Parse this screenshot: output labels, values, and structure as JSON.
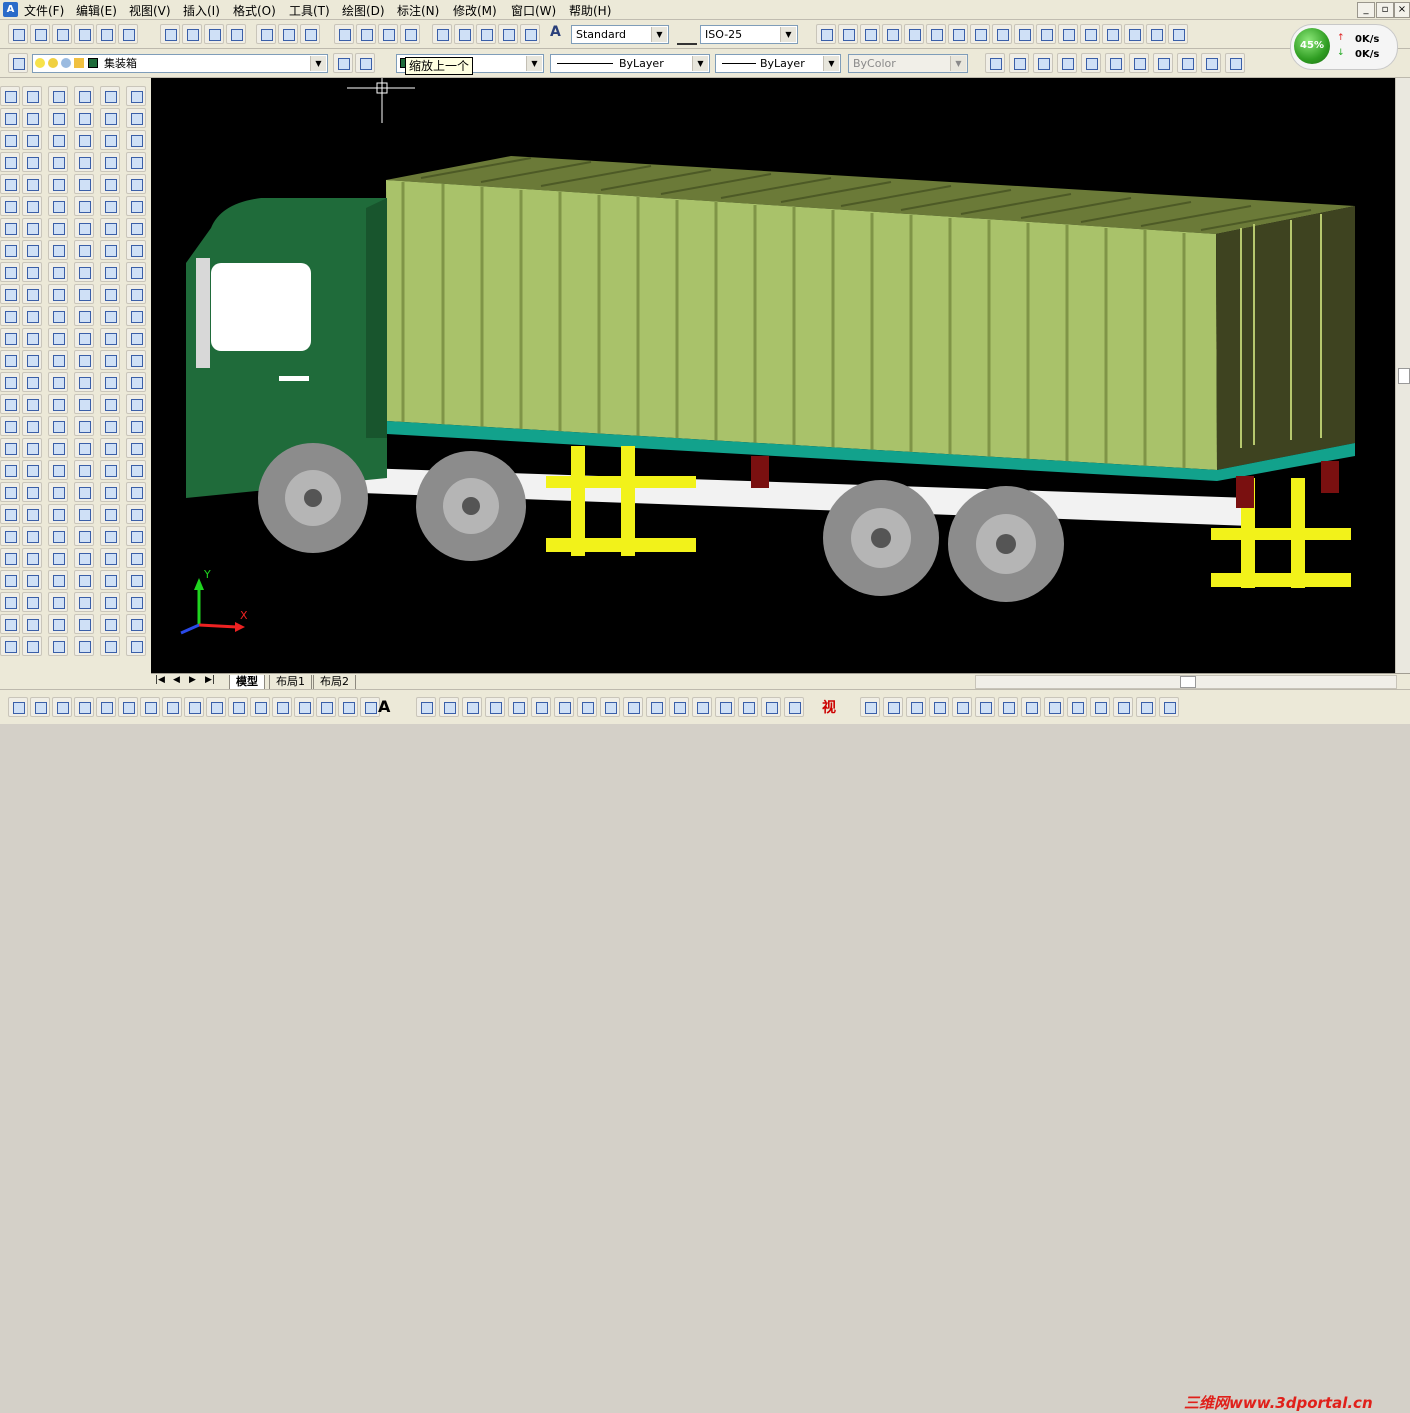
{
  "app": {
    "icon_label": "A"
  },
  "menu": [
    {
      "label": "文件(F)"
    },
    {
      "label": "编辑(E)"
    },
    {
      "label": "视图(V)"
    },
    {
      "label": "插入(I)"
    },
    {
      "label": "格式(O)"
    },
    {
      "label": "工具(T)"
    },
    {
      "label": "绘图(D)"
    },
    {
      "label": "标注(N)"
    },
    {
      "label": "修改(M)"
    },
    {
      "label": "窗口(W)"
    },
    {
      "label": "帮助(H)"
    }
  ],
  "window_controls": {
    "minimize": "_",
    "restore": "▫",
    "close": "×"
  },
  "styles_toolbar": {
    "text_style": "Standard",
    "dim_style": "ISO-25"
  },
  "layers_toolbar": {
    "layer_name": "集装箱"
  },
  "properties_toolbar": {
    "linetype": "ByLayer",
    "lineweight": "ByLayer",
    "plotstyle": "ByColor"
  },
  "tooltip": {
    "text": "缩放上一个"
  },
  "network_widget": {
    "percent": "45%",
    "up_speed": "0K/s",
    "down_speed": "0K/s"
  },
  "ucs": {
    "x_label": "X",
    "y_label": "Y"
  },
  "layout_tabs": [
    {
      "label": "模型",
      "active": true
    },
    {
      "label": "布局1",
      "active": false
    },
    {
      "label": "布局2",
      "active": false
    }
  ],
  "draw_toolbar": {
    "text_tool": "A",
    "view_label": "视"
  },
  "watermark": {
    "text": "三维网www.3dportal.cn"
  },
  "colors": {
    "viewport_bg": "#000000",
    "cab": "#1f6b3a",
    "container": "#a9c26a",
    "chassis": "#e8e830"
  }
}
